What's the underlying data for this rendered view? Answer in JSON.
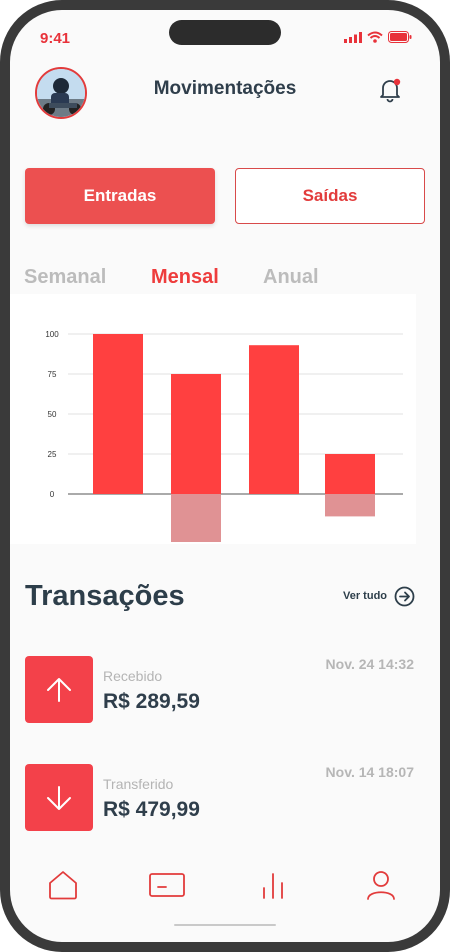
{
  "status": {
    "time": "9:41"
  },
  "header": {
    "title": "Movimentações"
  },
  "toggle": {
    "entradas_label": "Entradas",
    "saidas_label": "Saídas"
  },
  "period_tabs": [
    {
      "label": "Semanal",
      "active": false
    },
    {
      "label": "Mensal",
      "active": true
    },
    {
      "label": "Anual",
      "active": false
    }
  ],
  "chart_data": {
    "type": "bar",
    "categories": [
      "",
      "",
      "",
      ""
    ],
    "series": [
      {
        "values": [
          100,
          75,
          93,
          25
        ],
        "color": "#ff4040"
      },
      {
        "values": [
          0,
          -30,
          0,
          -14
        ],
        "color": "#e09294"
      }
    ],
    "yticks": [
      0,
      25,
      50,
      75,
      100
    ],
    "ylim": [
      -30,
      100
    ],
    "grid": true
  },
  "transactions": {
    "title": "Transações",
    "see_all_label": "Ver tudo",
    "items": [
      {
        "label": "Recebido",
        "amount": "R$ 289,59",
        "date": "Nov. 24 14:32",
        "icon": "arrow-up-icon"
      },
      {
        "label": "Transferido",
        "amount": "R$ 479,99",
        "date": "Nov. 14 18:07",
        "icon": "arrow-down-icon"
      }
    ]
  },
  "tabbar": {
    "items": [
      "home-icon",
      "card-icon",
      "chart-icon",
      "user-icon"
    ],
    "color": "#e23b3b"
  },
  "colors": {
    "accent": "#ee3c3c",
    "text_dark": "#2f3e4b",
    "muted": "#bcbcbc"
  }
}
